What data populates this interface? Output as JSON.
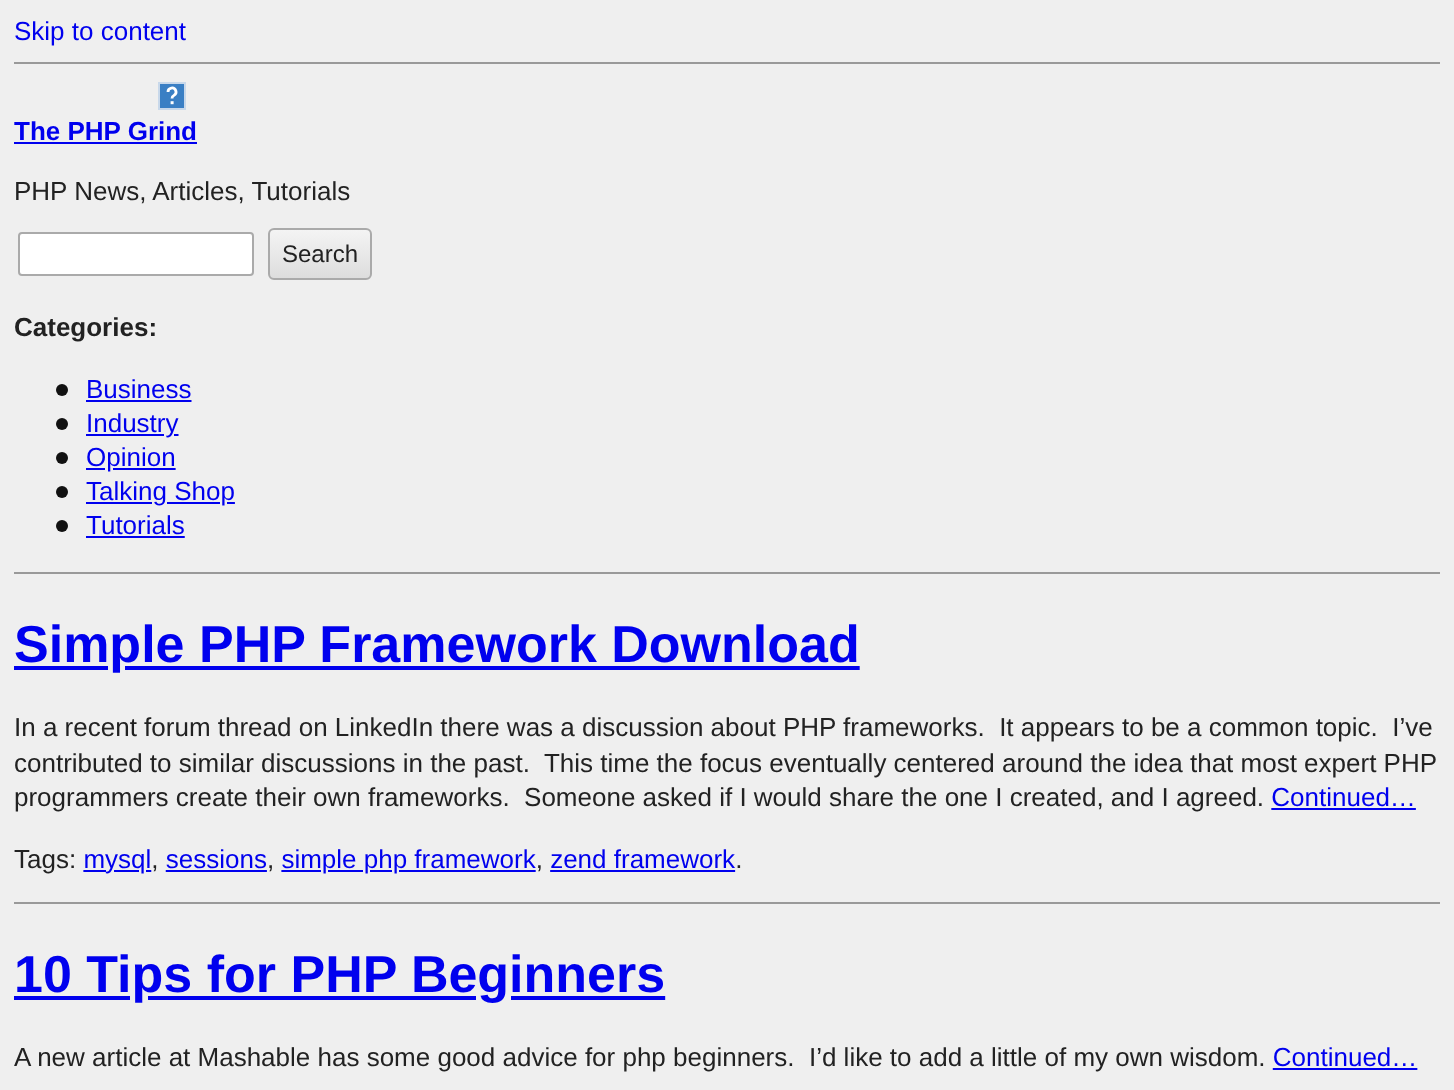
{
  "skip_link": "Skip to content",
  "site": {
    "title": "The PHP Grind",
    "tagline": "PHP News, Articles, Tutorials"
  },
  "search": {
    "button": "Search"
  },
  "categories": {
    "heading": "Categories:",
    "items": [
      "Business",
      "Industry",
      "Opinion",
      "Talking Shop",
      "Tutorials"
    ]
  },
  "posts": [
    {
      "title": "Simple PHP Framework Download",
      "excerpt": "In a recent forum thread on LinkedIn there was a discussion about PHP frameworks.  It appears to be a common topic.  I’ve contributed to similar discussions in the past.  This time the focus eventually centered around the idea that most expert PHP programmers create their own frameworks.  Someone asked if I would share the one I created, and I agreed. ",
      "more": "Continued…",
      "tags_label": "Tags: ",
      "tags": [
        "mysql",
        "sessions",
        "simple php framework",
        "zend framework"
      ],
      "tags_separator": ", ",
      "tags_end": "."
    },
    {
      "title": "10 Tips for PHP Beginners",
      "excerpt": "A new article at Mashable has some good advice for php beginners.  I’d like to add a little of my own wisdom. ",
      "more": "Continued…"
    }
  ]
}
